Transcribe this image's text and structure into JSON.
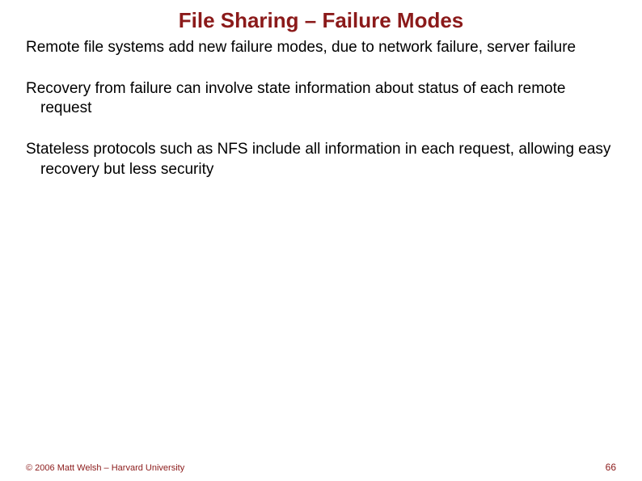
{
  "title": "File Sharing – Failure Modes",
  "bullets": {
    "b0": "Remote file systems add new failure modes, due to network failure, server failure",
    "b1": "Recovery from failure can involve state information about status of each remote request",
    "b2": "Stateless protocols such as NFS include all information in each request, allowing easy recovery but less security"
  },
  "footer": {
    "copyright": "© 2006 Matt Welsh – Harvard University",
    "page": "66"
  }
}
